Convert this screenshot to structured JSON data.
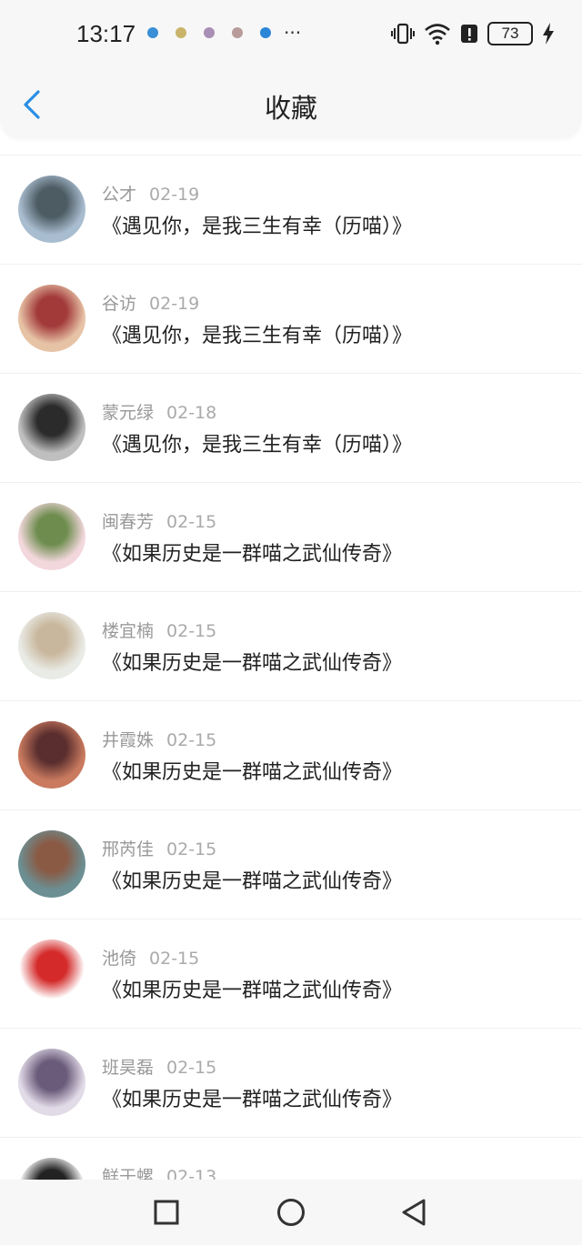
{
  "status": {
    "time": "13:17",
    "battery": "73",
    "more": "···",
    "notif_colors": [
      "#3a8fd6",
      "#c9b46a",
      "#a98eb5",
      "#b99b9b",
      "#2b86d8"
    ]
  },
  "header": {
    "title": "收藏",
    "accent": "#2a8fe6"
  },
  "items": [
    {
      "name": "公才",
      "date": "02-19",
      "title": "《遇见你，是我三生有幸（历喵）》",
      "avatar_colors": [
        "#a9bdd0",
        "#4d5b63"
      ]
    },
    {
      "name": "谷访",
      "date": "02-19",
      "title": "《遇见你，是我三生有幸（历喵）》",
      "avatar_colors": [
        "#e7c3a6",
        "#a23a3a"
      ]
    },
    {
      "name": "蒙元绿",
      "date": "02-18",
      "title": "《遇见你，是我三生有幸（历喵）》",
      "avatar_colors": [
        "#bfbfbf",
        "#2b2b2b"
      ]
    },
    {
      "name": "闽春芳",
      "date": "02-15",
      "title": "《如果历史是一群喵之武仙传奇》",
      "avatar_colors": [
        "#f2d7dc",
        "#6d8c4d"
      ]
    },
    {
      "name": "楼宜楠",
      "date": "02-15",
      "title": "《如果历史是一群喵之武仙传奇》",
      "avatar_colors": [
        "#e9ebe6",
        "#c9b79d"
      ]
    },
    {
      "name": "井霞姝",
      "date": "02-15",
      "title": "《如果历史是一群喵之武仙传奇》",
      "avatar_colors": [
        "#c97a5f",
        "#5a2e2e"
      ]
    },
    {
      "name": "邢芮佳",
      "date": "02-15",
      "title": "《如果历史是一群喵之武仙传奇》",
      "avatar_colors": [
        "#6c8f93",
        "#8a5a44"
      ]
    },
    {
      "name": "池倚",
      "date": "02-15",
      "title": "《如果历史是一群喵之武仙传奇》",
      "avatar_colors": [
        "#ffffff",
        "#d42a2a"
      ]
    },
    {
      "name": "班昊磊",
      "date": "02-15",
      "title": "《如果历史是一群喵之武仙传奇》",
      "avatar_colors": [
        "#e1dbe8",
        "#6b5b7a"
      ]
    },
    {
      "name": "鲜于螺",
      "date": "02-13",
      "title": "",
      "avatar_colors": [
        "#ffffff",
        "#222222"
      ]
    }
  ]
}
